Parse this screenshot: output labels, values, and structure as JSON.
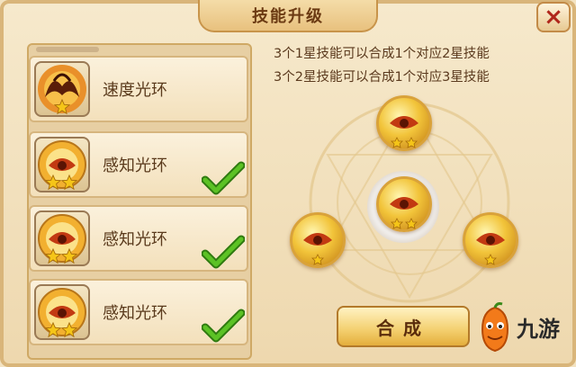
{
  "window": {
    "title": "技能升级",
    "close_label": "×"
  },
  "skills": [
    {
      "name": "速度光环",
      "stars": 1,
      "selected": false,
      "icon": "phoenix-wings-icon"
    },
    {
      "name": "感知光环",
      "stars": 2,
      "selected": true,
      "icon": "golden-eye-icon"
    },
    {
      "name": "感知光环",
      "stars": 2,
      "selected": true,
      "icon": "golden-eye-icon"
    },
    {
      "name": "感知光环",
      "stars": 2,
      "selected": true,
      "icon": "golden-eye-icon"
    }
  ],
  "info": {
    "line1": "3个1星技能可以合成1个对应2星技能",
    "line2": "3个2星技能可以合成1个对应3星技能"
  },
  "synthesis": {
    "slots": [
      {
        "position": "top",
        "stars": 2,
        "icon": "golden-eye-icon"
      },
      {
        "position": "center",
        "stars": 2,
        "icon": "golden-eye-icon"
      },
      {
        "position": "left",
        "stars": 1,
        "icon": "golden-eye-icon"
      },
      {
        "position": "right",
        "stars": 1,
        "icon": "golden-eye-icon"
      }
    ]
  },
  "merge_button": {
    "label": "合成"
  },
  "brand": {
    "name": "九游",
    "icon": "pepper-mascot-icon"
  },
  "colors": {
    "panel_bg": "#f6e9cc",
    "border": "#c8944a",
    "title_text": "#6b3a12",
    "check_green": "#4caf1c",
    "star_gold": "#f5c518"
  }
}
